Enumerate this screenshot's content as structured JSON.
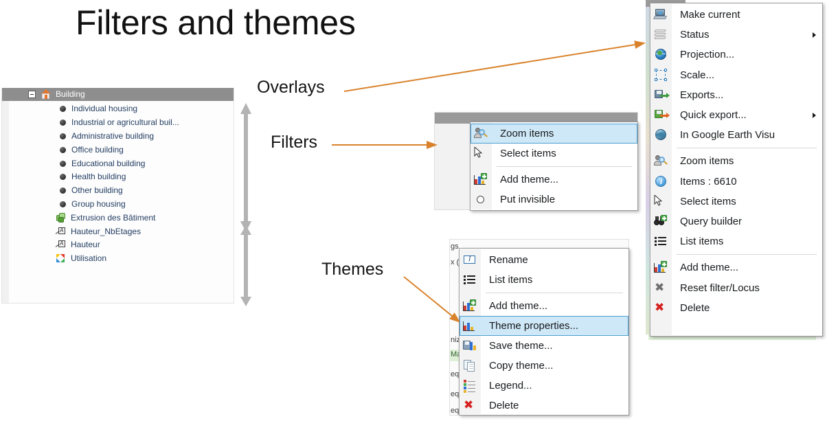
{
  "slide": {
    "title": "Filters and themes"
  },
  "annotations": [
    {
      "id": "overlays",
      "label": "Overlays"
    },
    {
      "id": "filters",
      "label": "Filters"
    },
    {
      "id": "themes",
      "label": "Themes"
    }
  ],
  "colors": {
    "arrow": "#d9822b",
    "menu_highlight_fill": "#cfe8f7",
    "menu_highlight_border": "#4a9fd4",
    "tree_header_bg": "#8e8e8e",
    "tree_label": "#1f3a5f",
    "delete_red": "#d5201f",
    "resize_arrow_gray": "#b0b0b0"
  },
  "tree_panel": {
    "header": {
      "label": "Building",
      "icon": "house-icon",
      "expander": "minus-expander-icon"
    },
    "items": [
      {
        "label": "Individual housing",
        "icon": "bullet-icon"
      },
      {
        "label": "Industrial or agricultural buil...",
        "icon": "bullet-icon"
      },
      {
        "label": "Administrative building",
        "icon": "bullet-icon"
      },
      {
        "label": "Office building",
        "icon": "bullet-icon"
      },
      {
        "label": "Educational building",
        "icon": "bullet-icon"
      },
      {
        "label": "Health building",
        "icon": "bullet-icon"
      },
      {
        "label": "Other building",
        "icon": "bullet-icon"
      },
      {
        "label": "Group housing",
        "icon": "bullet-icon"
      },
      {
        "label": "Extrusion des Bâtiment",
        "icon": "green-cube-icon"
      },
      {
        "label": "Hauteur_NbEtages",
        "icon": "text-label-icon"
      },
      {
        "label": "Hauteur",
        "icon": "text-label-icon"
      },
      {
        "label": "Utilisation",
        "icon": "pinwheel-theme-icon"
      }
    ]
  },
  "filters_menu": {
    "items": [
      {
        "label": "Zoom items",
        "icon": "zoom-items-icon",
        "selected": true,
        "separator_before": false,
        "submenu": false
      },
      {
        "label": "Select items",
        "icon": "cursor-arrow-icon",
        "selected": false,
        "separator_before": false,
        "submenu": false
      },
      {
        "label": "Add theme...",
        "icon": "add-theme-icon",
        "selected": false,
        "separator_before": true,
        "submenu": false
      },
      {
        "label": "Put invisible",
        "icon": "circle-outline-icon",
        "selected": false,
        "separator_before": false,
        "submenu": false
      }
    ]
  },
  "themes_menu": {
    "items": [
      {
        "label": "Rename",
        "icon": "rename-icon",
        "selected": false,
        "separator_before": false,
        "submenu": false
      },
      {
        "label": "List items",
        "icon": "list-items-icon",
        "selected": false,
        "separator_before": false,
        "submenu": false
      },
      {
        "label": "Add theme...",
        "icon": "add-theme-icon",
        "selected": false,
        "separator_before": true,
        "submenu": false
      },
      {
        "label": "Theme properties...",
        "icon": "theme-properties-icon",
        "selected": true,
        "separator_before": false,
        "submenu": false
      },
      {
        "label": "Save theme...",
        "icon": "save-theme-icon",
        "selected": false,
        "separator_before": false,
        "submenu": false
      },
      {
        "label": "Copy theme...",
        "icon": "copy-theme-icon",
        "selected": false,
        "separator_before": false,
        "submenu": false
      },
      {
        "label": "Legend...",
        "icon": "legend-icon",
        "selected": false,
        "separator_before": false,
        "submenu": false
      },
      {
        "label": "Delete",
        "icon": "delete-red-x-icon",
        "selected": false,
        "separator_before": false,
        "submenu": false
      }
    ],
    "background_text": [
      "gs",
      "x (",
      "niz",
      "Ma",
      "eq",
      "eq",
      "eq"
    ]
  },
  "overlays_menu": {
    "items": [
      {
        "label": "Make current",
        "icon": "make-current-icon",
        "selected": false,
        "separator_before": false,
        "submenu": false
      },
      {
        "label": "Status",
        "icon": "layers-icon",
        "selected": false,
        "separator_before": false,
        "submenu": true
      },
      {
        "label": "Projection...",
        "icon": "globe-icon",
        "selected": false,
        "separator_before": false,
        "submenu": false
      },
      {
        "label": "Scale...",
        "icon": "scale-icon",
        "selected": false,
        "separator_before": false,
        "submenu": false
      },
      {
        "label": "Exports...",
        "icon": "export-icon",
        "selected": false,
        "separator_before": false,
        "submenu": false
      },
      {
        "label": "Quick export...",
        "icon": "quick-export-icon",
        "selected": false,
        "separator_before": false,
        "submenu": true
      },
      {
        "label": "In Google Earth Visu",
        "icon": "google-earth-icon",
        "selected": false,
        "separator_before": false,
        "submenu": false
      },
      {
        "label": "Zoom items",
        "icon": "zoom-items-icon",
        "selected": false,
        "separator_before": true,
        "submenu": false
      },
      {
        "label": "Items : 6610",
        "icon": "info-icon",
        "selected": false,
        "separator_before": false,
        "submenu": false
      },
      {
        "label": "Select items",
        "icon": "cursor-arrow-icon",
        "selected": false,
        "separator_before": false,
        "submenu": false
      },
      {
        "label": "Query builder",
        "icon": "query-builder-icon",
        "selected": false,
        "separator_before": false,
        "submenu": false
      },
      {
        "label": "List items",
        "icon": "list-items-icon",
        "selected": false,
        "separator_before": false,
        "submenu": false
      },
      {
        "label": "Add theme...",
        "icon": "add-theme-icon",
        "selected": false,
        "separator_before": true,
        "submenu": false
      },
      {
        "label": "Reset filter/Locus",
        "icon": "reset-gray-x-icon",
        "selected": false,
        "separator_before": false,
        "submenu": false
      },
      {
        "label": "Delete",
        "icon": "delete-red-x-icon",
        "selected": false,
        "separator_before": false,
        "submenu": false
      }
    ]
  }
}
